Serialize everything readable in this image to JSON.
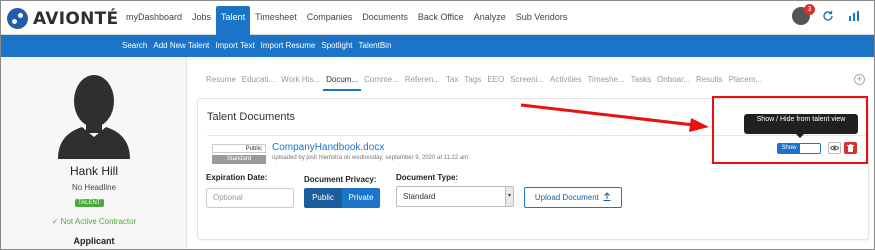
{
  "brand": {
    "name": "AVIONTÉ",
    "accent": "#1b74c8",
    "highlight": "#e81010"
  },
  "nav": {
    "items": [
      "myDashboard",
      "Jobs",
      "Talent",
      "Timesheet",
      "Companies",
      "Documents",
      "Back Office",
      "Analyze",
      "Sub Vendors"
    ],
    "active": "Talent",
    "notification_count": "3"
  },
  "subnav": {
    "items": [
      "Search",
      "Add New Talent",
      "Import Text",
      "Import Resume",
      "Spotlight",
      "TalentBin"
    ]
  },
  "profile": {
    "name": "Hank Hill",
    "headline": "No Headline",
    "badge": "TALENT",
    "status": "✓ Not Active Contractor",
    "role": "Applicant"
  },
  "tabs": {
    "items": [
      "Resume",
      "Educati...",
      "Work His...",
      "Docum...",
      "Comme...",
      "Referen...",
      "Tax",
      "Tags",
      "EEO",
      "Screeni...",
      "Activities",
      "Timeshe...",
      "Tasks",
      "Onboar...",
      "Results",
      "Placem..."
    ],
    "active": "Docum..."
  },
  "documents": {
    "title": "Talent Documents",
    "item": {
      "privacy": "Public",
      "type": "Standard",
      "filename": "CompanyHandbook.docx",
      "meta": "uploaded by josh hiemstra on wednesday, september 9, 2020 at 11:22 am"
    },
    "expiration_label": "Expiration Date:",
    "expiration_placeholder": "Optional",
    "privacy_label": "Document Privacy:",
    "privacy_public": "Public",
    "privacy_private": "Private",
    "type_label": "Document Type:",
    "type_value": "Standard",
    "upload_label": "Upload Document"
  },
  "tooltip": {
    "text": "Show / Hide from talent view"
  },
  "toggle": {
    "label": "Show"
  }
}
